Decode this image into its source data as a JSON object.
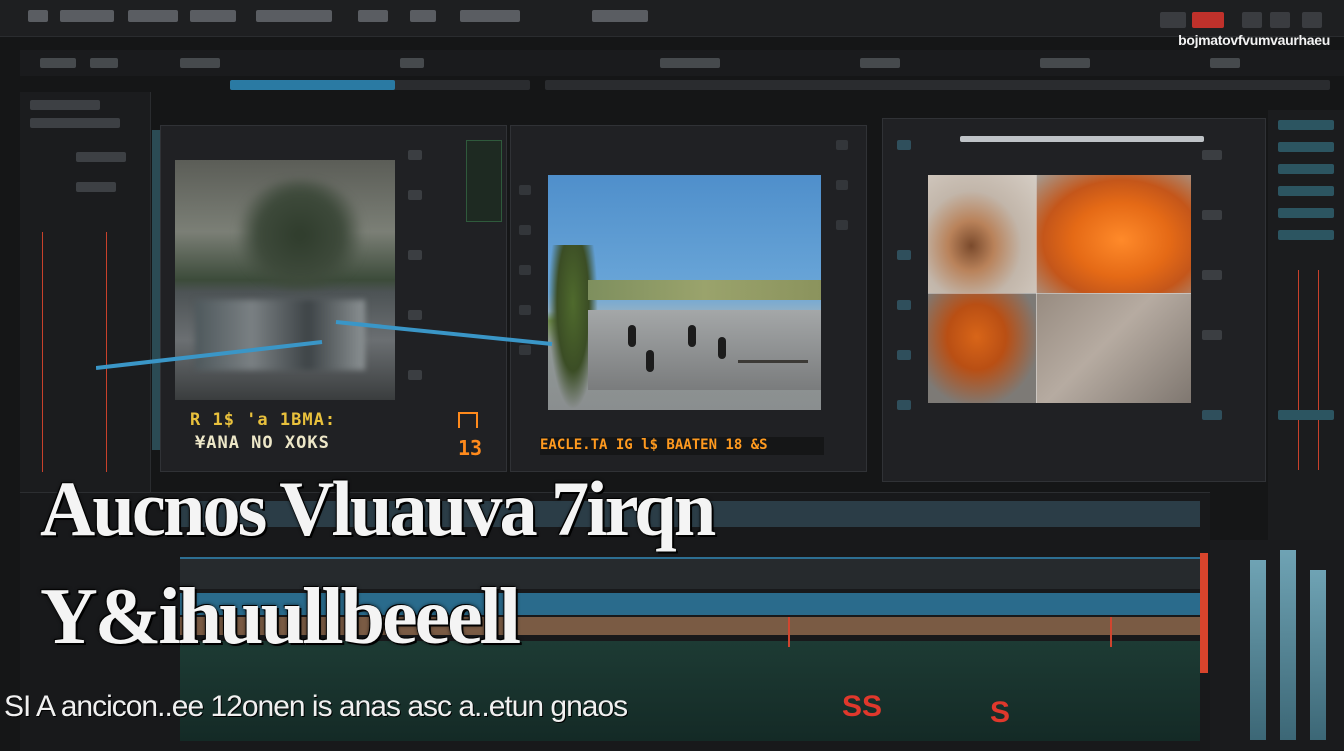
{
  "brand": "bojmatovfvumvaurhaeu",
  "left_viewer": {
    "caption_line1": "R 1$ 'a 1BMA:",
    "caption_line2": "¥ANA NO XOKS"
  },
  "center_viewer": {
    "caption": "EACLE.TA IG l$ BAATEN 18 &S"
  },
  "number_badge": "13",
  "overlay": {
    "title_line1": "Aucnos Vluauva 7irqn",
    "title_line2": "Y&ihuullbeeell",
    "subtitle": "SI A ancicon..ee 12onen is anas asc a..etun gnaos"
  },
  "timeline_markers": [
    "SS",
    "S"
  ],
  "colors": {
    "background": "#151617",
    "accent_blue": "#2a7aa3",
    "accent_orange": "#ff8a1c",
    "accent_red": "#d0452f"
  }
}
